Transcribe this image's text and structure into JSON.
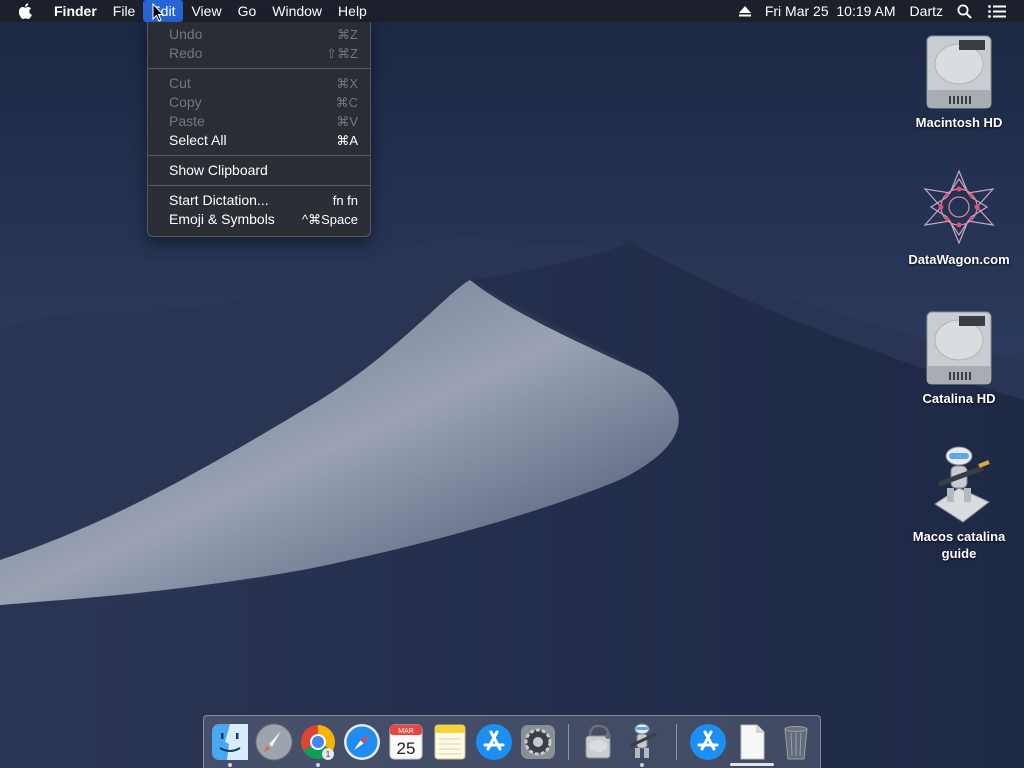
{
  "menubar": {
    "app_name": "Finder",
    "menus": [
      "File",
      "Edit",
      "View",
      "Go",
      "Window",
      "Help"
    ],
    "active_menu": "Edit",
    "clock": "Fri Mar 25  10:19 AM",
    "user": "Dartz",
    "icons": [
      "apple-icon",
      "eject-icon",
      "search-icon",
      "list-icon"
    ]
  },
  "edit_menu": {
    "undo": {
      "label": "Undo",
      "shortcut": "⌘Z"
    },
    "redo": {
      "label": "Redo",
      "shortcut": "⇧⌘Z"
    },
    "cut": {
      "label": "Cut",
      "shortcut": "⌘X"
    },
    "copy": {
      "label": "Copy",
      "shortcut": "⌘C"
    },
    "paste": {
      "label": "Paste",
      "shortcut": "⌘V"
    },
    "select_all": {
      "label": "Select All",
      "shortcut": "⌘A"
    },
    "show_clipboard": {
      "label": "Show Clipboard"
    },
    "start_dictation": {
      "label": "Start Dictation...",
      "shortcut": "fn fn"
    },
    "emoji": {
      "label": "Emoji & Symbols",
      "shortcut": "^⌘Space"
    }
  },
  "desktop_icons": {
    "macintosh_hd": "Macintosh HD",
    "datawagon": "DataWagon.com",
    "catalina_hd": "Catalina HD",
    "guide_line1": "Macos catalina",
    "guide_line2": "guide"
  },
  "dock": {
    "apps": [
      "finder-icon",
      "launchpad-icon",
      "chrome-icon",
      "safari-icon",
      "calendar-icon",
      "notes-icon",
      "app-store-icon",
      "system-preferences-icon",
      "disk-utility-icon",
      "automator-icon",
      "app-store-icon",
      "document-icon",
      "trash-icon"
    ],
    "calendar_month": "MAR",
    "calendar_day": "25",
    "chrome_badge": "1"
  },
  "colors": {
    "menu_highlight": "#2765d6",
    "desktop_sky": "#1e2d4d",
    "dune": "#8a93a6"
  }
}
